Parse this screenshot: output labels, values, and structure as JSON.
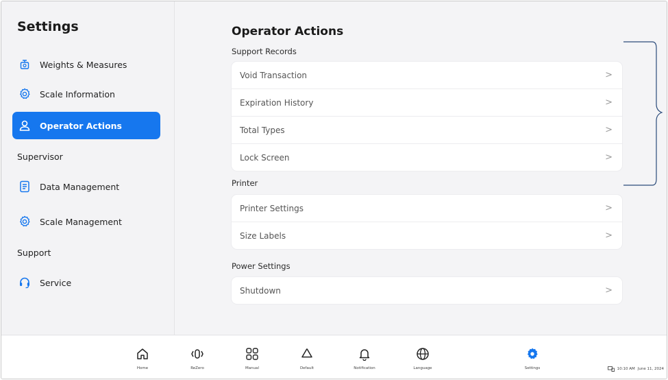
{
  "sidebar": {
    "title": "Settings",
    "items_top": [
      {
        "label": "Weights & Measures",
        "icon": "scale-icon"
      },
      {
        "label": "Scale Information",
        "icon": "gear-icon"
      },
      {
        "label": "Operator Actions",
        "icon": "user-icon",
        "active": true
      }
    ],
    "supervisor_label": "Supervisor",
    "supervisor_items": [
      {
        "label": "Data Management",
        "icon": "document-icon"
      },
      {
        "label": "Scale Management",
        "icon": "gear-icon"
      }
    ],
    "support_label": "Support",
    "support_items": [
      {
        "label": "Service",
        "icon": "headset-icon"
      }
    ]
  },
  "main": {
    "title": "Operator Actions",
    "support_records": {
      "label": "Support Records",
      "rows": [
        "Void Transaction",
        "Expiration History",
        "Total Types",
        "Lock Screen"
      ]
    },
    "printer": {
      "label": "Printer",
      "rows": [
        "Printer Settings",
        "Size Labels"
      ]
    },
    "power": {
      "label": "Power Settings",
      "rows": [
        "Shutdown"
      ]
    },
    "chevron": ">"
  },
  "bottom_nav": [
    {
      "label": "Home",
      "icon": "home-icon"
    },
    {
      "label": "ReZero",
      "icon": "rezero-icon"
    },
    {
      "label": "Manual",
      "icon": "grid-icon"
    },
    {
      "label": "Default",
      "icon": "recycle-icon"
    },
    {
      "label": "Notification",
      "icon": "bell-icon"
    },
    {
      "label": "Language",
      "icon": "globe-icon"
    },
    {
      "label": "Settings",
      "icon": "gear-icon",
      "active": true
    }
  ],
  "status": {
    "time": "10:10 AM",
    "date": "June 11, 2024"
  },
  "colors": {
    "accent": "#1677ee",
    "background": "#f4f4f6",
    "card": "#ffffff"
  }
}
